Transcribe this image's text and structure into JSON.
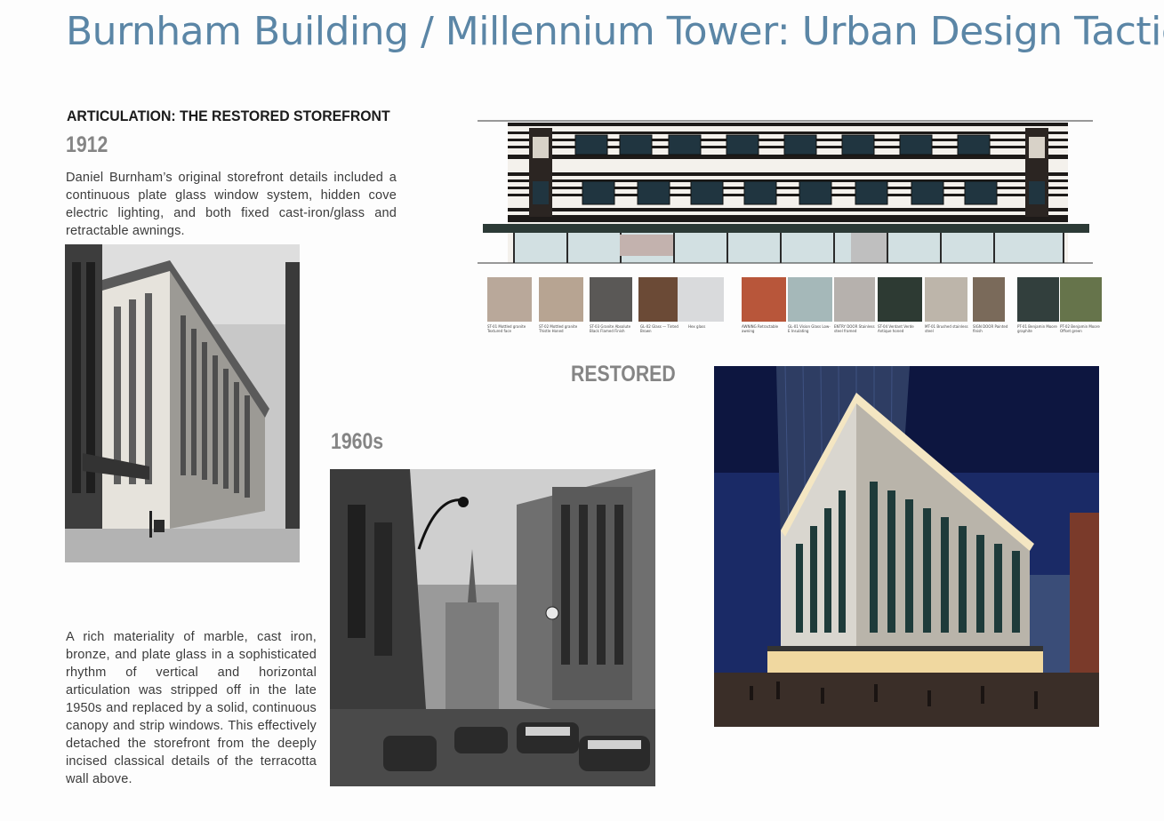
{
  "page": {
    "title": "Burnham Building / Millennium Tower: Urban Design Tactics"
  },
  "section": {
    "heading": "ARTICULATION: THE RESTORED STOREFRONT"
  },
  "eras": {
    "e1912": "1912",
    "e1960s": "1960s",
    "restored": "RESTORED"
  },
  "paragraphs": {
    "storefront_1912": "Daniel Burnham’s original storefront details included a continuous plate glass window system, hidden cove electric lighting, and both fixed cast-iron/glass and retractable awnings.",
    "materiality": "A rich materiality of marble, cast iron, bronze, and plate glass in a sophisticated rhythm of vertical and horizontal articulation was stripped off in the late 1950s and replaced by a solid, continuous canopy and strip windows. This effectively detached the storefront from the deeply incised classical details of the terracotta wall above."
  },
  "colors": {
    "title": "#5b86a6",
    "era": "#858585",
    "body_text": "#3b3b3b"
  },
  "material_swatches": [
    {
      "color": "#b9a89a",
      "label": "ST-01 Mottled granite Textured face"
    },
    {
      "color": "#b7a492",
      "label": "ST-02 Mottled granite Thistle Honed"
    },
    {
      "color": "#5a5856",
      "label": "ST-03 Granite Absolute Black Flamed Finish"
    },
    {
      "color": "#6b4a36",
      "label": "GL-02 Glass — Tinted Brown"
    },
    {
      "color": "#d9dadc",
      "label": "Hex glass"
    },
    {
      "color": "#b8563a",
      "label": "AWNING Retractable awning"
    },
    {
      "color": "#a5b8b9",
      "label": "GL-01 Vision Glass Low-E Insulating"
    },
    {
      "color": "#b6b1ad",
      "label": "ENTRY DOOR Stainless steel framed"
    },
    {
      "color": "#2d3a33",
      "label": "ST-04 Verdant Verde Antique honed"
    },
    {
      "color": "#bdb5aa",
      "label": "MT-01 Brushed stainless steel"
    },
    {
      "color": "#7a6a5a",
      "label": "SIGN DOOR Painted finish"
    },
    {
      "color": "#323f3d",
      "label": "PT-01 Benjamin Moore graphite"
    },
    {
      "color": "#66744b",
      "label": "PT-02 Benjamin Moore Offset green"
    }
  ]
}
